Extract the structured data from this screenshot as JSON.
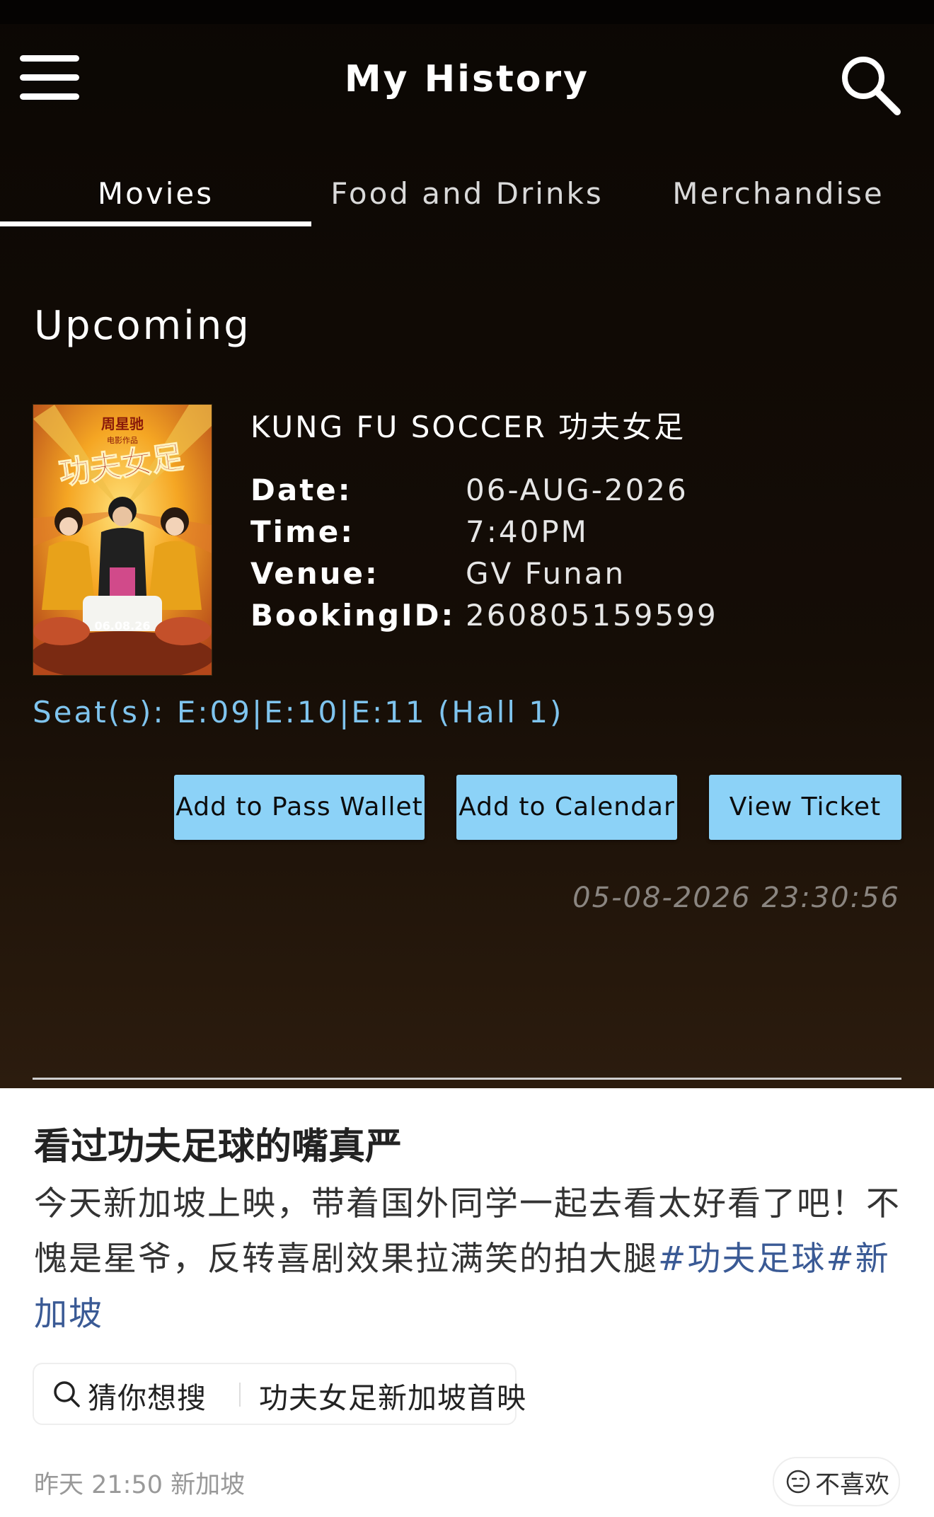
{
  "header": {
    "title": "My History",
    "menu_icon": "hamburger-menu-icon",
    "search_icon": "search-icon"
  },
  "tabs": [
    {
      "label": "Movies",
      "active": true
    },
    {
      "label": "Food and Drinks",
      "active": false
    },
    {
      "label": "Merchandise",
      "active": false
    }
  ],
  "section_title": "Upcoming",
  "booking": {
    "movie_title": "KUNG FU SOCCER 功夫女足",
    "poster": {
      "brand_text": "周星驰",
      "brand_sub": "电影作品",
      "title_text": "功夫女足",
      "date_text": "06.08.26"
    },
    "details": [
      {
        "label": "Date:",
        "value": "06-AUG-2026"
      },
      {
        "label": "Time:",
        "value": "7:40PM"
      },
      {
        "label": "Venue:",
        "value": "GV Funan"
      },
      {
        "label": "BookingID:",
        "value": "260805159599"
      }
    ],
    "seats": "Seat(s): E:09|E:10|E:11 (Hall 1)",
    "buttons": {
      "pass_wallet": "Add to Pass Wallet",
      "calendar": "Add to Calendar",
      "view_ticket": "View Ticket"
    },
    "timestamp": "05-08-2026 23:30:56"
  },
  "post": {
    "title": "看过功夫足球的嘴真严",
    "body_text": "今天新加坡上映，带着国外同学一起去看太好看了吧！不愧是星爷，反转喜剧效果拉满笑的拍大腿",
    "hashtag_1": "#功夫足球#",
    "hashtag_2": "新加坡",
    "suggest_label": "猜你想搜",
    "suggest_query": "功夫女足新加坡首映",
    "meta": "昨天 21:50 新加坡",
    "dislike_label": "不喜欢"
  },
  "colors": {
    "seat_text": "#7fc4ee",
    "button_bg": "#8cd2f7",
    "hashtag": "#3a5a95"
  }
}
